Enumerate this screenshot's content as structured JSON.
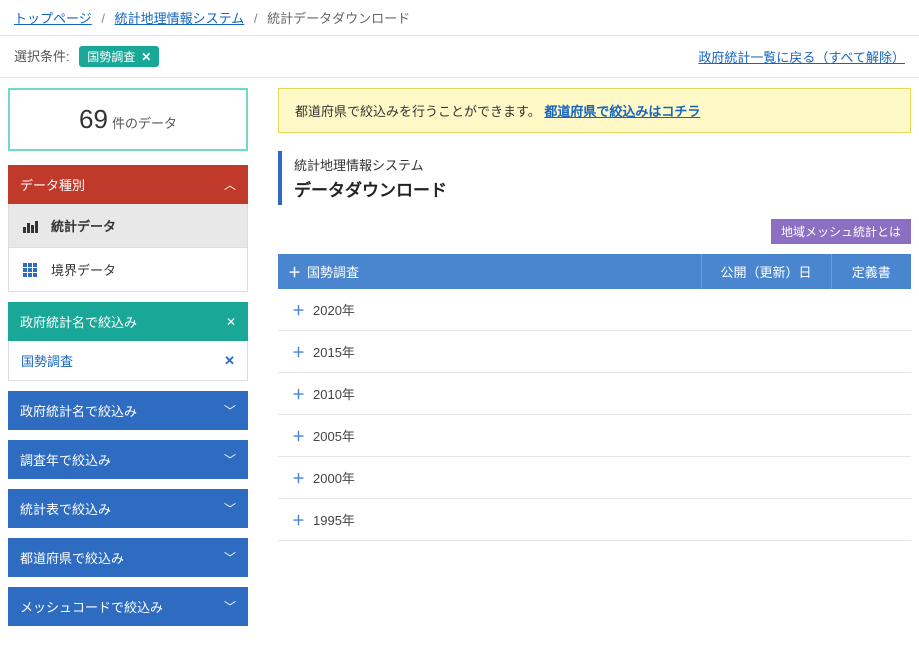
{
  "breadcrumb": {
    "items": [
      "トップページ",
      "統計地理情報システム"
    ],
    "current": "統計データダウンロード"
  },
  "filterBar": {
    "label": "選択条件:",
    "tag": "国勢調査",
    "resetLink": "政府統計一覧に戻る（すべて解除）"
  },
  "count": {
    "num": "69",
    "txt": "件のデータ"
  },
  "sidebar": {
    "typeHeader": "データ種別",
    "typeItems": [
      {
        "label": "統計データ",
        "active": true
      },
      {
        "label": "境界データ",
        "active": false
      }
    ],
    "nameFilterHeader": "政府統計名で絞込み",
    "nameFilterSelected": "国勢調査",
    "collapsePanels": [
      "政府統計名で絞込み",
      "調査年で絞込み",
      "統計表で絞込み",
      "都道府県で絞込み",
      "メッシュコードで絞込み"
    ]
  },
  "notice": {
    "text": "都道府県で絞込みを行うことができます。",
    "link": "都道府県で絞込みはコチラ"
  },
  "pageTitle": {
    "sub": "統計地理情報システム",
    "main": "データダウンロード"
  },
  "badge": "地域メッシュ統計とは",
  "table": {
    "headers": {
      "name": "国勢調査",
      "pub": "公開（更新）日",
      "def": "定義書"
    },
    "rows": [
      "2020年",
      "2015年",
      "2010年",
      "2005年",
      "2000年",
      "1995年"
    ]
  }
}
